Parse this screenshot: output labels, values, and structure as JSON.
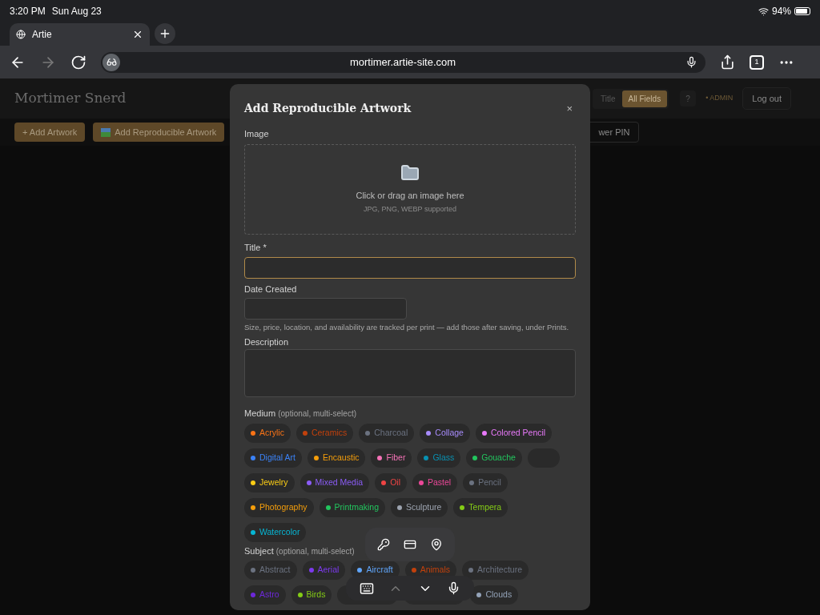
{
  "status_bar": {
    "time": "3:20 PM",
    "date": "Sun Aug 23",
    "battery": "94%"
  },
  "browser": {
    "tab_title": "Artie",
    "url": "mortimer.artie-site.com",
    "tab_count": "1"
  },
  "site": {
    "title": "Mortimer Snerd",
    "search_modes": [
      {
        "label": "Title",
        "selected": false
      },
      {
        "label": "All Fields",
        "selected": true
      }
    ],
    "help": "?",
    "role": "• ADMIN",
    "logout": "Log out",
    "actions": [
      {
        "label": "+ Add Artwork",
        "icon": false
      },
      {
        "label": "Add Reproducible Artwork",
        "icon": true
      }
    ],
    "pin_button": "wer PIN"
  },
  "modal": {
    "title": "Add Reproducible Artwork",
    "close": "×",
    "image": {
      "label": "Image",
      "prompt": "Click or drag an image here",
      "formats": "JPG, PNG, WEBP supported"
    },
    "title_field": {
      "label": "Title *",
      "focused": true
    },
    "date_field": {
      "label": "Date Created"
    },
    "note": "Size, price, location, and availability are tracked per print — add those after saving, under Prints.",
    "description": {
      "label": "Description"
    },
    "medium": {
      "label": "Medium",
      "hint": "(optional, multi-select)",
      "chips": [
        {
          "label": "Acrylic",
          "color": "#f97316",
          "kind": "chip"
        },
        {
          "label": "Ceramics",
          "color": "#c2410c",
          "kind": "chip"
        },
        {
          "label": "Charcoal",
          "color": "#6b7280",
          "kind": "chip"
        },
        {
          "label": "Collage",
          "color": "#a78bfa",
          "kind": "chip"
        },
        {
          "label": "Colored Pencil",
          "color": "#e879f9",
          "kind": "chip"
        },
        {
          "label": "Digital Art",
          "color": "#3b82f6",
          "kind": "chip"
        },
        {
          "label": "Encaustic",
          "color": "#f59e0b",
          "kind": "chip"
        },
        {
          "label": "Fiber",
          "color": "#f472b6",
          "kind": "chip"
        },
        {
          "label": "Glass",
          "color": "#0891b2",
          "kind": "chip"
        },
        {
          "label": "Gouache",
          "color": "#22c55e",
          "kind": "chip"
        },
        {
          "kind": "covered",
          "wide": false
        },
        {
          "label": "Jewelry",
          "color": "#facc15",
          "kind": "chip"
        },
        {
          "label": "Mixed Media",
          "color": "#8b5cf6",
          "kind": "chip"
        },
        {
          "label": "Oil",
          "color": "#ef4444",
          "kind": "chip"
        },
        {
          "label": "Pastel",
          "color": "#ec4899",
          "kind": "chip"
        },
        {
          "label": "Pencil",
          "color": "#6b7280",
          "kind": "chip"
        },
        {
          "label": "Photography",
          "color": "#f59e0b",
          "kind": "chip"
        },
        {
          "label": "Printmaking",
          "color": "#22c55e",
          "kind": "chip"
        },
        {
          "label": "Sculpture",
          "color": "#9ca3af",
          "kind": "chip"
        },
        {
          "label": "Tempera",
          "color": "#84cc16",
          "kind": "chip"
        },
        {
          "label": "Watercolor",
          "color": "#06b6d4",
          "kind": "chip"
        }
      ]
    },
    "subject": {
      "label": "Subject",
      "hint": "(optional, multi-select)",
      "chips": [
        {
          "label": "Abstract",
          "color": "#6b7280",
          "kind": "chip"
        },
        {
          "label": "Aerial",
          "color": "#7c3aed",
          "kind": "chip"
        },
        {
          "label": "Aircraft",
          "color": "#60a5fa",
          "kind": "chip"
        },
        {
          "label": "Animals",
          "color": "#c2410c",
          "kind": "chip"
        },
        {
          "label": "Architecture",
          "color": "#6b7280",
          "kind": "chip"
        },
        {
          "label": "Astro",
          "color": "#6d28d9",
          "kind": "chip"
        },
        {
          "label": "Birds",
          "color": "#84cc16",
          "kind": "chip"
        },
        {
          "kind": "covered",
          "wide": true
        },
        {
          "kind": "covered",
          "wide": true
        },
        {
          "label": "Clouds",
          "color": "#94a3b8",
          "kind": "chip"
        }
      ]
    }
  }
}
